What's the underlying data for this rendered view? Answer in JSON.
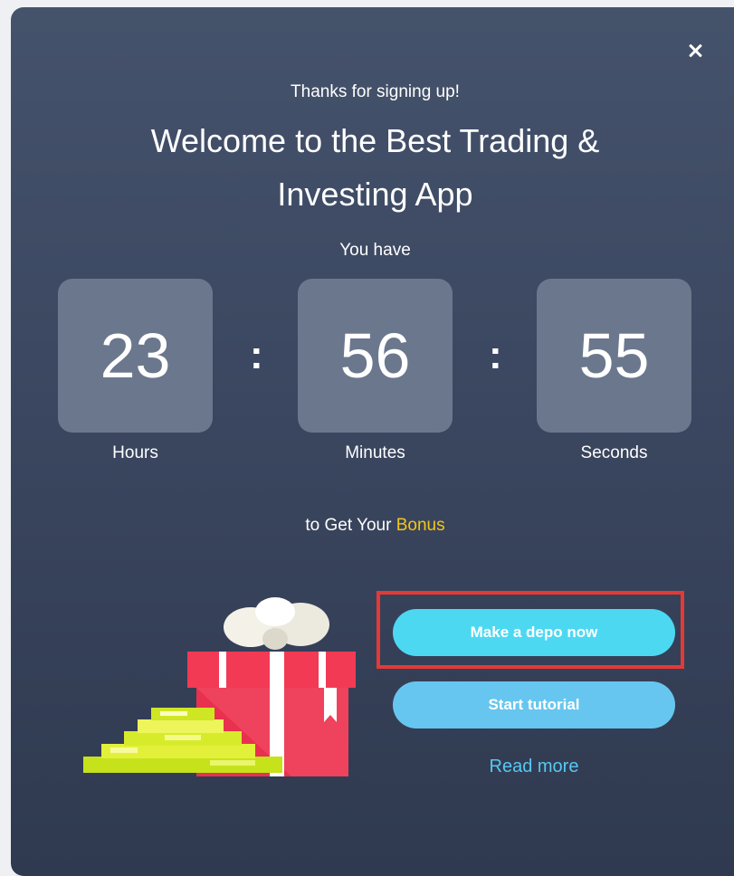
{
  "modal": {
    "subtitle": "Thanks for signing up!",
    "title": "Welcome to the Best Trading & Investing App",
    "intro": "You have",
    "timer": {
      "hours": "23",
      "minutes": "56",
      "seconds": "55",
      "separator": ":",
      "hours_label": "Hours",
      "minutes_label": "Minutes",
      "seconds_label": "Seconds"
    },
    "bonus_prefix": "to Get Your ",
    "bonus_word": "Bonus",
    "buttons": {
      "deposit": "Make a depo now",
      "tutorial": "Start tutorial",
      "read_more": "Read more"
    },
    "icons": {
      "close": "close-icon",
      "illustration": "gift-and-coins-illustration"
    }
  },
  "colors": {
    "accent_bonus": "#f5c518",
    "primary_button": "#4dd8f2",
    "secondary_button": "#67c6ef",
    "highlight_border": "#e53935"
  }
}
